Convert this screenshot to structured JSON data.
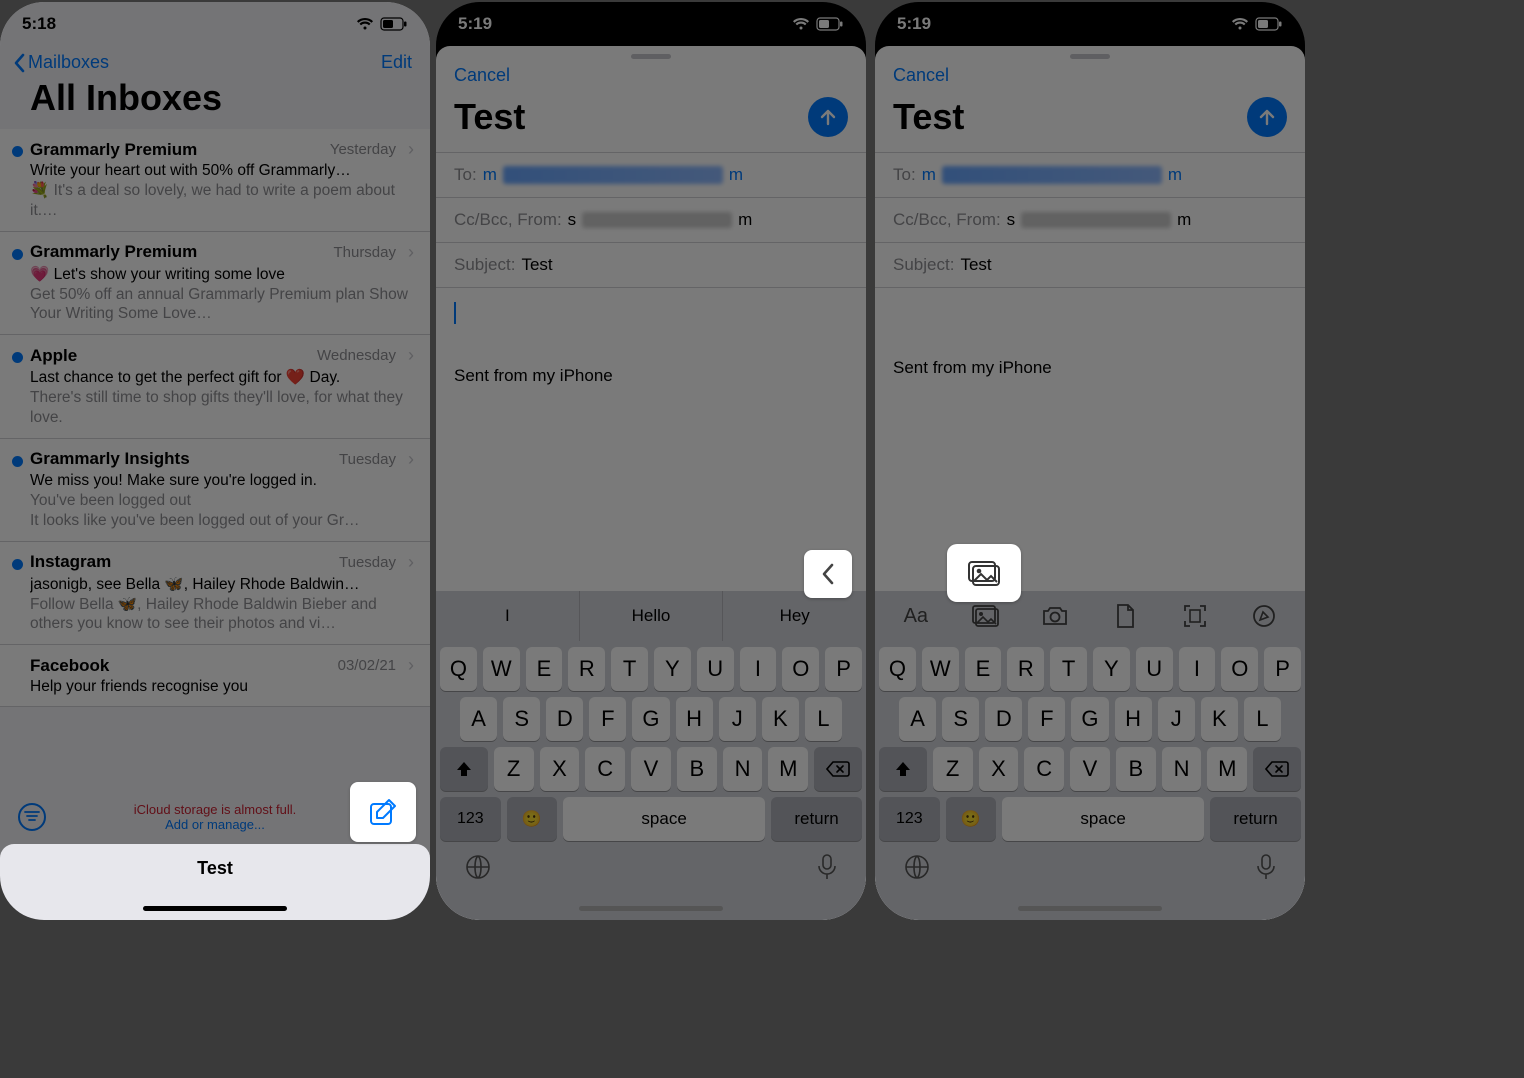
{
  "s1": {
    "time": "5:18",
    "nav_back": "Mailboxes",
    "nav_edit": "Edit",
    "title": "All Inboxes",
    "storage1": "iCloud storage is almost full.",
    "storage2": "Add or manage...",
    "draft_title": "Test",
    "rows": [
      {
        "sender": "Grammarly Premium",
        "date": "Yesterday",
        "subj": "Write your heart out with 50% off Grammarly…",
        "prev": "💐 It's a deal so lovely, we had to write a poem about it.…",
        "dot": true
      },
      {
        "sender": "Grammarly Premium",
        "date": "Thursday",
        "subj": "💗 Let's show your writing some love",
        "prev": "Get 50% off an annual Grammarly Premium plan Show Your Writing Some Love…",
        "dot": true
      },
      {
        "sender": "Apple",
        "date": "Wednesday",
        "subj": "Last chance to get the perfect gift for ❤️ Day.",
        "prev": "There's still time to shop gifts they'll love, for what they love.",
        "dot": true
      },
      {
        "sender": "Grammarly Insights",
        "date": "Tuesday",
        "subj": "We miss you! Make sure you're logged in.",
        "prev": "You've been logged out\nIt looks like you've been logged out of your Gr…",
        "dot": true
      },
      {
        "sender": "Instagram",
        "date": "Tuesday",
        "subj": "jasonigb, see Bella 🦋, Hailey Rhode Baldwin…",
        "prev": "Follow Bella 🦋, Hailey Rhode Baldwin Bieber and others you know to see their photos and vi…",
        "dot": true
      },
      {
        "sender": "Facebook",
        "date": "03/02/21",
        "subj": "Help your friends recognise you",
        "prev": "",
        "dot": false
      }
    ]
  },
  "compose": {
    "time": "5:19",
    "cancel": "Cancel",
    "title": "Test",
    "to_label": "To:",
    "to_prefix": "m",
    "to_suffix": "m",
    "cc_label": "Cc/Bcc, From:",
    "from_prefix": "s",
    "from_suffix": "m",
    "subj_label": "Subject:",
    "subj_value": "Test",
    "signature": "Sent from my iPhone"
  },
  "keyboard": {
    "suggestions": [
      "I",
      "Hello",
      "Hey"
    ],
    "r1": [
      "Q",
      "W",
      "E",
      "R",
      "T",
      "Y",
      "U",
      "I",
      "O",
      "P"
    ],
    "r2": [
      "A",
      "S",
      "D",
      "F",
      "G",
      "H",
      "J",
      "K",
      "L"
    ],
    "r3": [
      "Z",
      "X",
      "C",
      "V",
      "B",
      "N",
      "M"
    ],
    "numkey": "123",
    "space": "space",
    "return": "return",
    "attach_aa": "Aa"
  }
}
